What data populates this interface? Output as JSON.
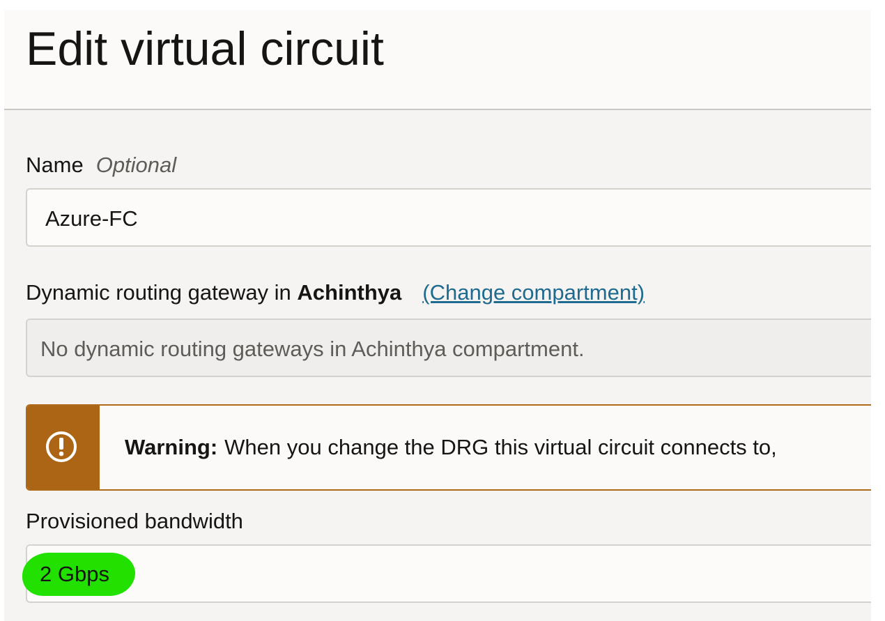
{
  "title": "Edit virtual circuit",
  "name_field": {
    "label": "Name",
    "optional_label": "Optional",
    "value": "Azure-FC"
  },
  "drg_field": {
    "label_prefix": "Dynamic routing gateway in",
    "compartment": "Achinthya",
    "change_link": "(Change compartment)",
    "value": "No dynamic routing gateways in Achinthya compartment."
  },
  "warning": {
    "icon": "exclamation-circle-icon",
    "title": "Warning:",
    "text": "When you change the DRG this virtual circuit connects to,",
    "color": "#ac6515"
  },
  "bandwidth_field": {
    "label": "Provisioned bandwidth",
    "value": "2 Gbps",
    "highlight_color": "#22e000"
  }
}
